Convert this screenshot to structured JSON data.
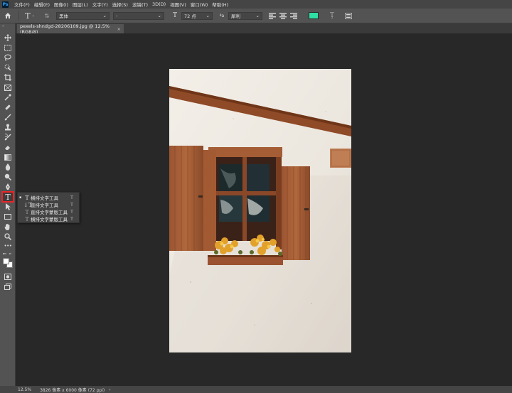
{
  "app": {
    "logo": "Ps"
  },
  "menu": [
    "文件(F)",
    "编辑(E)",
    "图像(I)",
    "图层(L)",
    "文字(Y)",
    "选择(S)",
    "滤镜(T)",
    "3D(D)",
    "视图(V)",
    "窗口(W)",
    "帮助(H)"
  ],
  "options": {
    "font_family": "黑体",
    "font_style": "-",
    "font_size": "72 点",
    "anti_alias": "犀利",
    "text_color": "#2fe0a4"
  },
  "document_tab": {
    "title": "pexels-shndgd-28206109.jpg @ 12.5%(RGB/8)",
    "close": "×"
  },
  "flyout": {
    "items": [
      {
        "label": "横排文字工具",
        "shortcut": "T",
        "selected": true
      },
      {
        "label": "直排文字工具",
        "shortcut": "T",
        "selected": false
      },
      {
        "label": "直排文字蒙版工具",
        "shortcut": "T",
        "selected": false
      },
      {
        "label": "横排文字蒙版工具",
        "shortcut": "T",
        "selected": false
      }
    ]
  },
  "status": {
    "zoom": "12.5%",
    "doc_info": "3826 像素 x 6000 像素 (72 ppi)",
    "arrow": "›"
  }
}
